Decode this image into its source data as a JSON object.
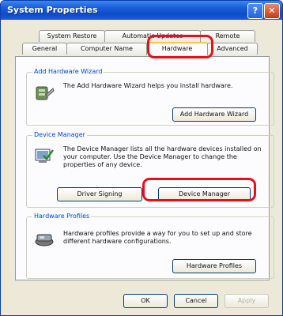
{
  "window": {
    "title": "System Properties",
    "help_glyph": "?",
    "close_glyph": "✕"
  },
  "tabs_back": [
    "System Restore",
    "Automatic Updates",
    "Remote"
  ],
  "tabs_front": [
    "General",
    "Computer Name",
    "Hardware",
    "Advanced"
  ],
  "groups": {
    "add_hardware": {
      "title": "Add Hardware Wizard",
      "description": "The Add Hardware Wizard helps you install hardware.",
      "button": "Add Hardware Wizard",
      "icon": "add-hardware-icon"
    },
    "device_manager": {
      "title": "Device Manager",
      "description": "The Device Manager lists all the hardware devices installed on your computer. Use the Device Manager to change the properties of any device.",
      "button_signing": "Driver Signing",
      "button_manager": "Device Manager",
      "icon": "device-manager-icon"
    },
    "hardware_profiles": {
      "title": "Hardware Profiles",
      "description": "Hardware profiles provide a way for you to set up and store different hardware configurations.",
      "button": "Hardware Profiles",
      "icon": "hardware-profiles-icon"
    }
  },
  "footer": {
    "ok": "OK",
    "cancel": "Cancel",
    "apply": "Apply"
  },
  "colors": {
    "title_bar": "#1c5fdb",
    "annotation": "#e3101d",
    "group_title": "#0046d5"
  }
}
